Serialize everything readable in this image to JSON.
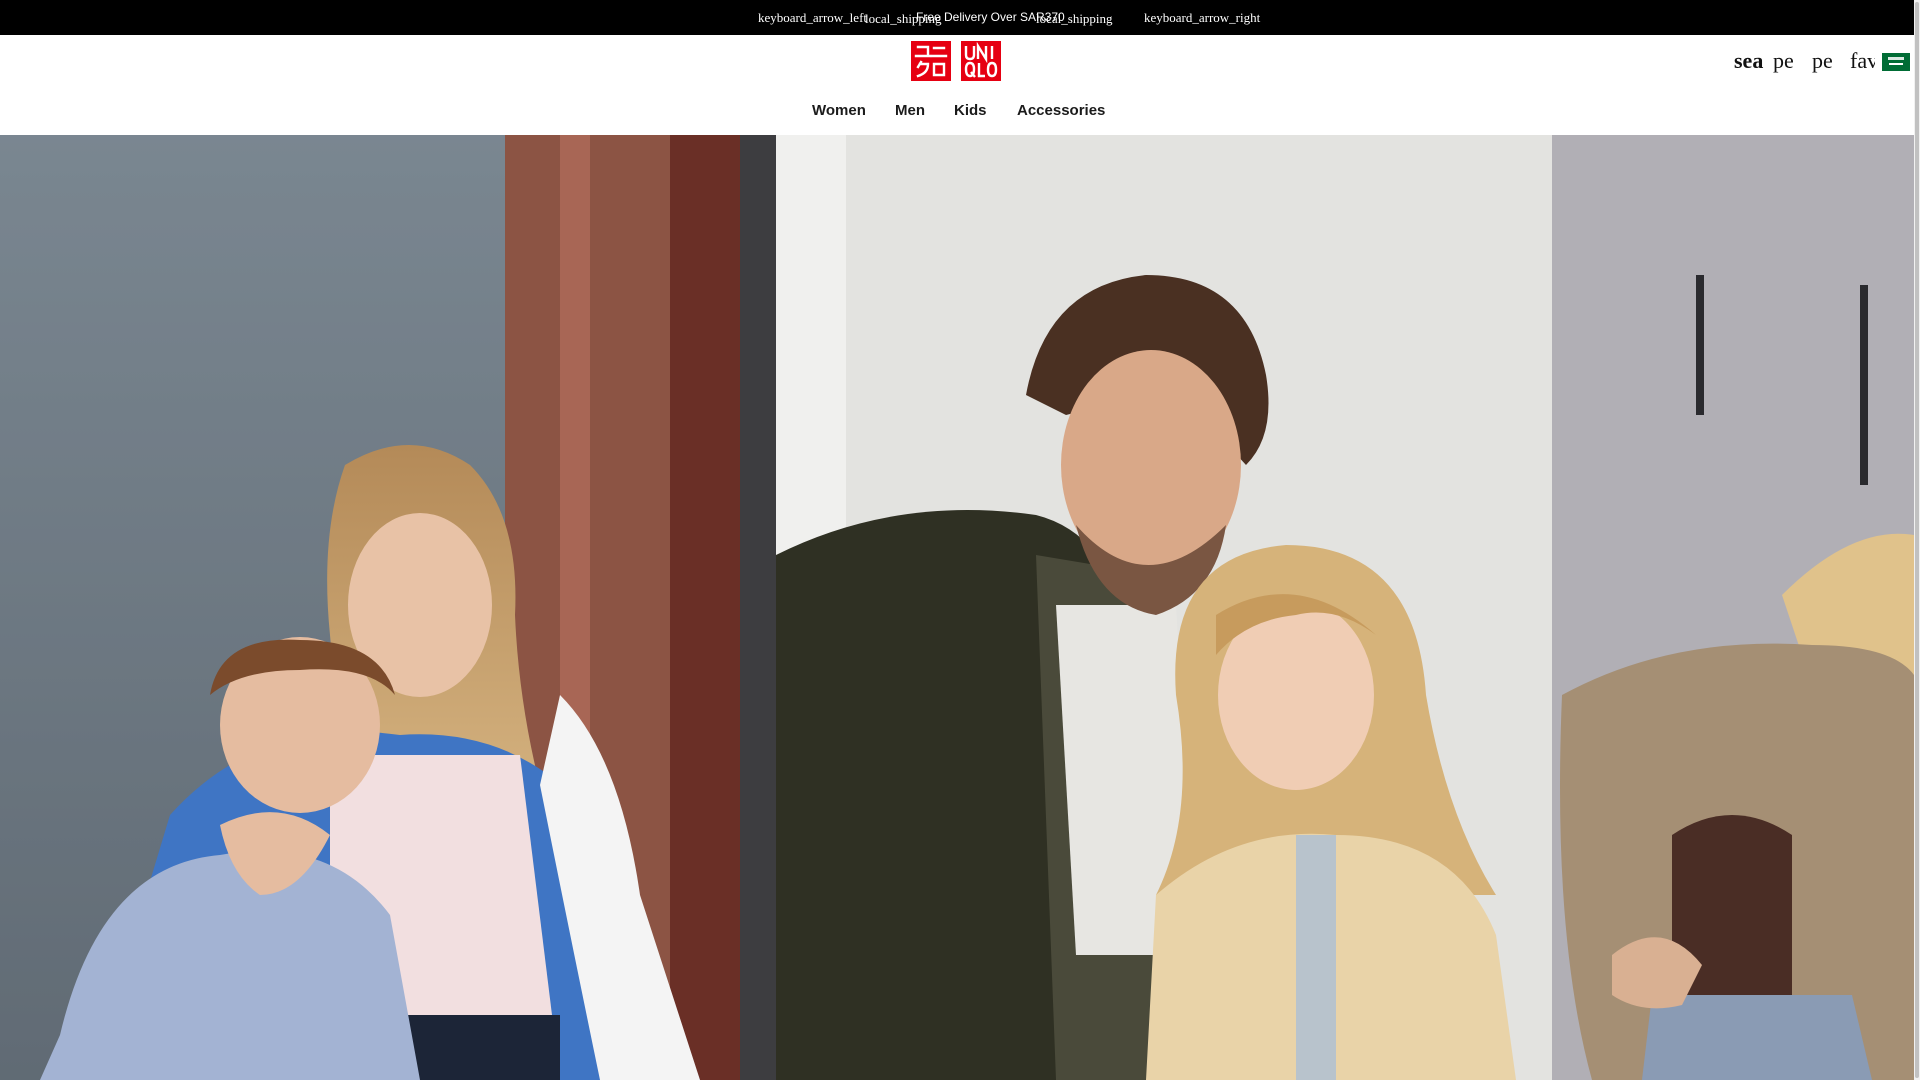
{
  "announcement": {
    "arrow_left": "keyboard_arrow_left",
    "shipping_icon_a": "local_shipping",
    "message": "Free Delivery Over SAR370",
    "shipping_icon_b": "local_shipping",
    "arrow_right": "keyboard_arrow_right"
  },
  "header": {
    "logo": {
      "brand": "UNIQLO",
      "top_left": "ユニ",
      "bottom_left": "クロ",
      "top_right": "UNI",
      "bottom_right": "QLO",
      "color": "#e60012"
    },
    "utility": {
      "search": "sea",
      "person_1": "pe",
      "person_2": "pe",
      "favorites": "fav",
      "flag_icon": "saudi-arabia-flag-icon"
    },
    "nav": [
      "Women",
      "Men",
      "Kids",
      "Accessories"
    ]
  },
  "hero": {
    "panels": [
      {
        "name": "hero-panel-women-kids",
        "image": "woman-hugging-boy-photo"
      },
      {
        "name": "hero-panel-men-kids",
        "image": "man-with-girl-photo"
      },
      {
        "name": "hero-panel-women",
        "image": "woman-quilted-jacket-photo"
      }
    ]
  },
  "colors": {
    "topbar": "#000000",
    "brand_red": "#e60012",
    "background": "#ffffff",
    "text": "#1b1b1b"
  }
}
